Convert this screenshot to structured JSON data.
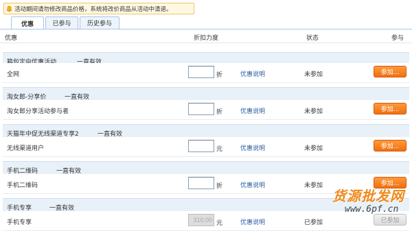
{
  "notice": {
    "text": "活动期间请勿修改商品价格，系统将改价商品从活动中清退。",
    "icon": "bell-icon"
  },
  "tabs": [
    {
      "label": "优惠",
      "active": true
    },
    {
      "label": "已参与",
      "active": false
    },
    {
      "label": "历史参与",
      "active": false
    }
  ],
  "columns": {
    "name": "优惠",
    "discount": "折扣力度",
    "status": "状态",
    "join": "参与"
  },
  "groups": [
    {
      "title": "箱包定向优惠活动",
      "validity": "一直有效",
      "row": {
        "name": "全网",
        "value": "",
        "unit": "折",
        "link": "优惠说明",
        "status": "未参加",
        "button": "参加...",
        "disabled": false
      }
    },
    {
      "title": "淘女郎-分享价",
      "validity": "一直有效",
      "row": {
        "name": "淘女郎分享活动参与者",
        "value": "",
        "unit": "折",
        "link": "优惠说明",
        "status": "未参加",
        "button": "参加...",
        "disabled": false
      }
    },
    {
      "title": "天猫年中促无线渠道专享2",
      "validity": "一直有效",
      "row": {
        "name": "无线渠道用户",
        "value": "",
        "unit": "元",
        "link": "优惠说明",
        "status": "未参加",
        "button": "参加...",
        "disabled": false
      }
    },
    {
      "title": "手机二维码",
      "validity": "一直有效",
      "row": {
        "name": "手机二维码",
        "value": "",
        "unit": "折",
        "link": "优惠说明",
        "status": "未参加",
        "button": "参加...",
        "disabled": false
      }
    },
    {
      "title": "手机专享",
      "validity": "一直有效",
      "row": {
        "name": "手机专享",
        "value": "310.00",
        "unit": "元",
        "link": "优惠说明",
        "status": "已参加",
        "button": "已参加",
        "disabled": true
      }
    }
  ],
  "watermark": {
    "line1": "货源批发网",
    "line2": "www.6pf.cn"
  },
  "colors": {
    "accent_orange": "#f0700f",
    "group_bg": "#e8f0f8",
    "link_blue": "#2a5d9f",
    "notice_bg": "#fff8e1"
  }
}
